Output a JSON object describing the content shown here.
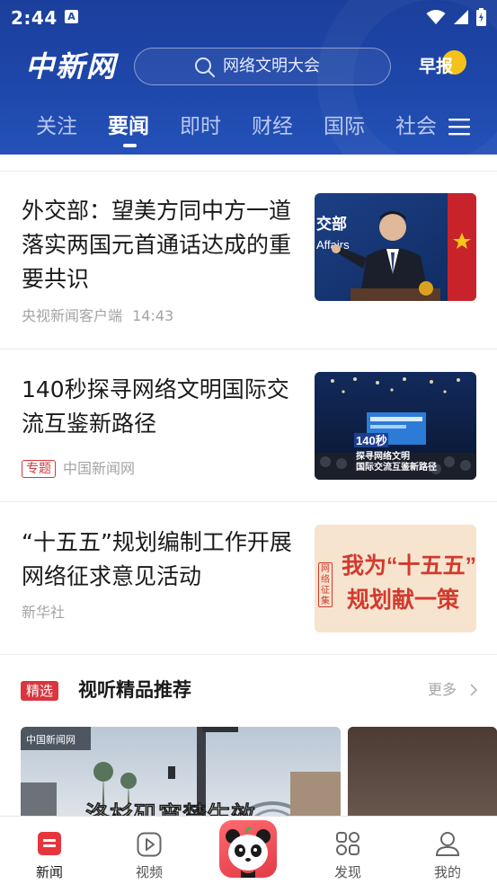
{
  "status_bar": {
    "time": "2:44",
    "notification_letter": "A"
  },
  "header": {
    "logo_text": "中新网",
    "search_placeholder": "网络文明大会",
    "zaobao_label": "早报",
    "accent_color": "#1e47aa"
  },
  "tabs": [
    {
      "label": "关注",
      "active": false
    },
    {
      "label": "要闻",
      "active": true
    },
    {
      "label": "即时",
      "active": false
    },
    {
      "label": "财经",
      "active": false
    },
    {
      "label": "国际",
      "active": false
    },
    {
      "label": "社会",
      "active": false
    }
  ],
  "articles": [
    {
      "title": "外交部：望美方同中方一道落实两国元首通话达成的重要共识",
      "source": "央视新闻客户端",
      "time": "14:43",
      "tag": "",
      "thumb_text": "交部 Affairs"
    },
    {
      "title": "140秒探寻网络文明国际交流互鉴新路径",
      "source": "中国新闻网",
      "time": "",
      "tag": "专题",
      "thumb_text": "140秒 探寻网络文明 国际交流互鉴新路径"
    },
    {
      "title": "“十五五”规划编制工作开展网络征求意见活动",
      "source": "新华社",
      "time": "",
      "tag": "",
      "thumb_text_line1": "我为“十五五”",
      "thumb_text_line2": "规划献一策",
      "thumb_seal": "网络征集"
    }
  ],
  "featured_section": {
    "badge": "精选",
    "title": "视听精品推荐",
    "more_label": "更多",
    "video_cards": [
      {
        "overlay_text": "洛杉矶宵禁生效",
        "watermark": "中国新闻网"
      },
      {
        "overlay_text": ""
      }
    ]
  },
  "bottom_nav": [
    {
      "label": "新闻",
      "icon": "news-icon",
      "active": true
    },
    {
      "label": "视频",
      "icon": "video-play-icon",
      "active": false
    },
    {
      "label": "",
      "icon": "panda-mascot-icon",
      "active": false
    },
    {
      "label": "发现",
      "icon": "discover-grid-icon",
      "active": false
    },
    {
      "label": "我的",
      "icon": "profile-icon",
      "active": false
    }
  ]
}
